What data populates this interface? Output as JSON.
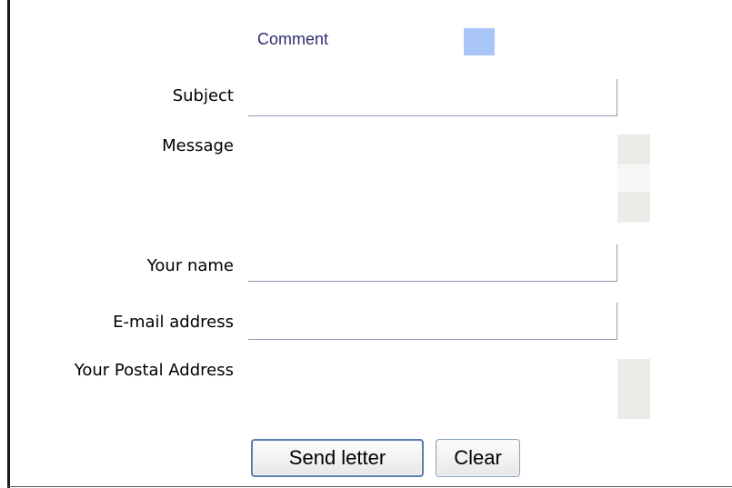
{
  "header": {
    "comment_label": "Comment"
  },
  "form": {
    "subject_label": "Subject",
    "message_label": "Message",
    "name_label": "Your name",
    "email_label": "E-mail address",
    "postal_label": "Your Postal Address",
    "subject_value": "",
    "message_value": "",
    "name_value": "",
    "email_value": "",
    "postal_value": ""
  },
  "buttons": {
    "send_label": "Send letter",
    "clear_label": "Clear"
  }
}
